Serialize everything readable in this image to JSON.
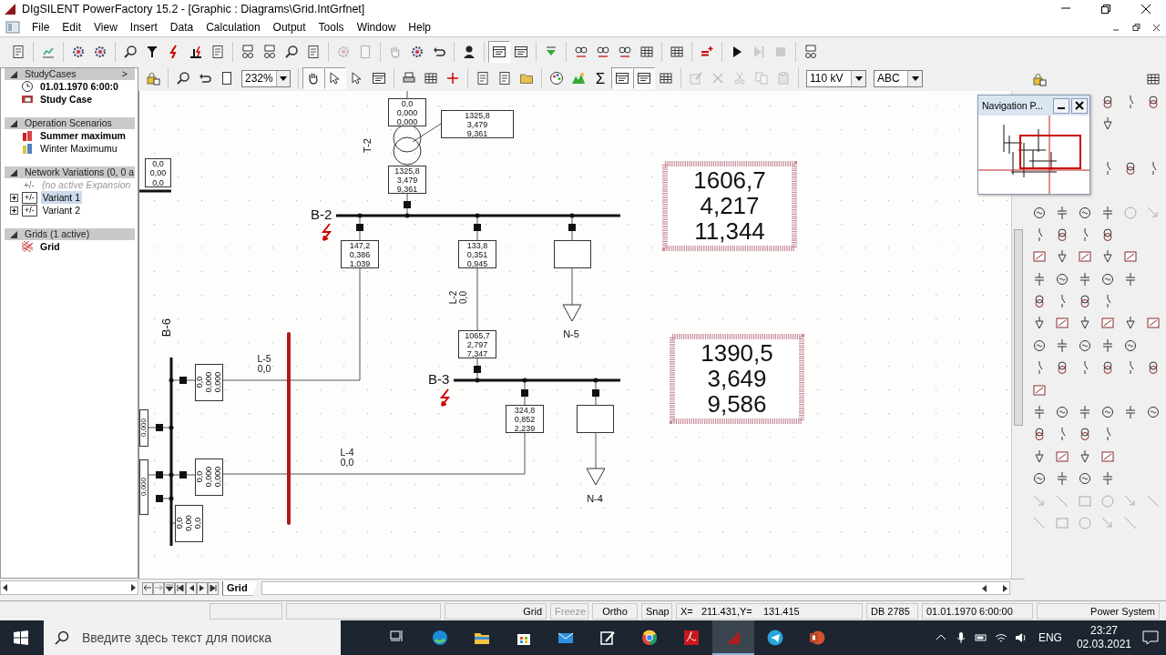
{
  "window": {
    "title": "DIgSILENT PowerFactory 15.2 - [Graphic : Diagrams\\Grid.IntGrfnet]"
  },
  "menu": [
    "File",
    "Edit",
    "View",
    "Insert",
    "Data",
    "Calculation",
    "Output",
    "Tools",
    "Window",
    "Help"
  ],
  "toolbar_main": [
    {
      "kind": "icon",
      "disabled": false,
      "pressed": false
    },
    {
      "kind": "separator"
    },
    {
      "kind": "icon",
      "disabled": false,
      "pressed": false
    },
    {
      "kind": "separator"
    },
    {
      "kind": "icon",
      "disabled": false,
      "pressed": false
    },
    {
      "kind": "icon",
      "disabled": false,
      "pressed": false
    },
    {
      "kind": "separator"
    },
    {
      "kind": "icon",
      "disabled": false,
      "pressed": false
    },
    {
      "kind": "icon",
      "disabled": false,
      "pressed": false
    },
    {
      "kind": "icon",
      "disabled": false,
      "pressed": false
    },
    {
      "kind": "icon",
      "disabled": false,
      "pressed": false
    },
    {
      "kind": "icon",
      "disabled": false,
      "pressed": false
    },
    {
      "kind": "separator"
    },
    {
      "kind": "icon",
      "disabled": false,
      "pressed": false
    },
    {
      "kind": "icon",
      "disabled": false,
      "pressed": false
    },
    {
      "kind": "icon",
      "disabled": false,
      "pressed": false
    },
    {
      "kind": "icon",
      "disabled": false,
      "pressed": false
    },
    {
      "kind": "separator"
    },
    {
      "kind": "icon",
      "disabled": true,
      "pressed": false
    },
    {
      "kind": "icon",
      "disabled": true,
      "pressed": false
    },
    {
      "kind": "separator"
    },
    {
      "kind": "icon",
      "disabled": true,
      "pressed": false
    },
    {
      "kind": "icon",
      "disabled": false,
      "pressed": false
    },
    {
      "kind": "icon",
      "disabled": false,
      "pressed": false
    },
    {
      "kind": "separator"
    },
    {
      "kind": "icon",
      "disabled": false,
      "pressed": false
    },
    {
      "kind": "separator"
    },
    {
      "kind": "icon",
      "disabled": false,
      "pressed": true
    },
    {
      "kind": "icon",
      "disabled": false,
      "pressed": false
    },
    {
      "kind": "separator"
    },
    {
      "kind": "icon",
      "disabled": false,
      "pressed": false
    },
    {
      "kind": "separator"
    },
    {
      "kind": "icon",
      "disabled": false,
      "pressed": false
    },
    {
      "kind": "icon",
      "disabled": false,
      "pressed": false
    },
    {
      "kind": "icon",
      "disabled": false,
      "pressed": false
    },
    {
      "kind": "icon",
      "disabled": false,
      "pressed": false
    },
    {
      "kind": "separator"
    },
    {
      "kind": "icon",
      "disabled": false,
      "pressed": false
    },
    {
      "kind": "separator"
    },
    {
      "kind": "icon",
      "disabled": false,
      "pressed": false
    },
    {
      "kind": "separator"
    },
    {
      "kind": "icon",
      "disabled": false,
      "pressed": false
    },
    {
      "kind": "icon",
      "disabled": true,
      "pressed": false
    },
    {
      "kind": "icon",
      "disabled": true,
      "pressed": false
    },
    {
      "kind": "separator"
    },
    {
      "kind": "icon",
      "disabled": false,
      "pressed": false
    }
  ],
  "toolbar_graphic": [
    {
      "kind": "icon",
      "disabled": false,
      "pressed": false
    },
    {
      "kind": "separator"
    },
    {
      "kind": "icon",
      "disabled": false,
      "pressed": false
    },
    {
      "kind": "icon",
      "disabled": false,
      "pressed": false
    },
    {
      "kind": "icon",
      "disabled": false,
      "pressed": false
    },
    {
      "kind": "combo",
      "value": "232%"
    },
    {
      "kind": "separator"
    },
    {
      "kind": "icon",
      "disabled": false,
      "pressed": true
    },
    {
      "kind": "icon",
      "disabled": false,
      "pressed": true
    },
    {
      "kind": "icon",
      "disabled": false,
      "pressed": false
    },
    {
      "kind": "icon",
      "disabled": false,
      "pressed": false
    },
    {
      "kind": "separator"
    },
    {
      "kind": "icon",
      "disabled": false,
      "pressed": false
    },
    {
      "kind": "icon",
      "disabled": false,
      "pressed": false
    },
    {
      "kind": "icon",
      "disabled": false,
      "pressed": false
    },
    {
      "kind": "separator"
    },
    {
      "kind": "icon",
      "disabled": false,
      "pressed": false
    },
    {
      "kind": "icon",
      "disabled": false,
      "pressed": false
    },
    {
      "kind": "icon",
      "disabled": false,
      "pressed": false
    },
    {
      "kind": "separator"
    },
    {
      "kind": "icon",
      "disabled": false,
      "pressed": false
    },
    {
      "kind": "icon",
      "disabled": false,
      "pressed": false
    },
    {
      "kind": "glyph",
      "text": "Σ",
      "disabled": false,
      "pressed": false
    },
    {
      "kind": "icon",
      "disabled": false,
      "pressed": true
    },
    {
      "kind": "icon",
      "disabled": false,
      "pressed": true
    },
    {
      "kind": "icon",
      "disabled": false,
      "pressed": false
    },
    {
      "kind": "separator"
    },
    {
      "kind": "icon",
      "disabled": true,
      "pressed": false
    },
    {
      "kind": "icon",
      "disabled": true,
      "pressed": false
    },
    {
      "kind": "icon",
      "disabled": true,
      "pressed": false
    },
    {
      "kind": "icon",
      "disabled": true,
      "pressed": false
    },
    {
      "kind": "icon",
      "disabled": true,
      "pressed": false
    },
    {
      "kind": "separator"
    },
    {
      "kind": "combo",
      "value": "110 kV"
    },
    {
      "kind": "combo",
      "value": "ABC"
    }
  ],
  "project_tree": [
    {
      "title": "StudyCases",
      "more": ">",
      "items": [
        {
          "kind": "item",
          "label": "01.01.1970 6:00:0",
          "active": true,
          "selected": false
        },
        {
          "kind": "item",
          "label": "Study Case",
          "active": true,
          "selected": false
        }
      ]
    },
    {
      "title": "Operation Scenarios",
      "items": [
        {
          "kind": "item",
          "label": "Summer maximum",
          "active": true,
          "selected": false
        },
        {
          "kind": "item",
          "label": "Winter Maximumu",
          "active": false,
          "selected": false
        }
      ]
    },
    {
      "title": "Network Variations (0, 0 a",
      "items": [
        {
          "kind": "note",
          "tag": "+/-",
          "label": "(no active Expansion",
          "active": false,
          "selected": false
        },
        {
          "kind": "variant",
          "tag": "+/-",
          "label": "Variant 1",
          "active": false,
          "selected": true,
          "expanded": false
        },
        {
          "kind": "variant",
          "tag": "+/-",
          "label": "Variant 2",
          "active": false,
          "selected": false,
          "expanded": false
        }
      ]
    },
    {
      "title": "Grids (1 active)",
      "items": [
        {
          "kind": "item",
          "label": "Grid",
          "active": true,
          "selected": false
        }
      ]
    }
  ],
  "diagram": {
    "labels": [
      "T-2",
      "B-2",
      "L-2",
      "0,0",
      "N-5",
      "B-3",
      "N-4",
      "B-6",
      "L-5",
      "0,0",
      "L-4",
      "0,0"
    ],
    "result_boxes": [
      {
        "lines": [
          "0,0",
          "0,000",
          "0,000"
        ]
      },
      {
        "lines": [
          "1325,8",
          "3,479",
          "9,361"
        ]
      },
      {
        "lines": [
          "1325,8",
          "3,479",
          "9,361"
        ]
      },
      {
        "lines": [
          "147,2",
          "0,386",
          "1,039"
        ]
      },
      {
        "lines": [
          "133,8",
          "0,351",
          "0,945"
        ]
      },
      {
        "lines": [
          "1065,7",
          "2,797",
          "7,347"
        ]
      },
      {
        "lines": [
          "324,8",
          "0,852",
          "2,239"
        ]
      },
      {
        "lines": [
          "0,0",
          "0,00",
          "0,0"
        ]
      },
      {
        "lines": [
          "0,0",
          "0,000",
          "0,000"
        ]
      },
      {
        "lines": [
          "0,0",
          "0,000",
          "0,000"
        ]
      },
      {
        "lines": [
          "0,0",
          "0,00",
          "0,0"
        ]
      },
      {
        "lines": [
          "0,000"
        ]
      },
      {
        "lines": [
          "0,000"
        ]
      }
    ],
    "summary_boxes": [
      {
        "lines": [
          "1606,7",
          "4,217",
          "11,344"
        ]
      },
      {
        "lines": [
          "1390,5",
          "3,649",
          "9,586"
        ]
      }
    ]
  },
  "navigation_panel": {
    "title": "Navigation P..."
  },
  "page_tabs": [
    {
      "label": "Grid",
      "selected": true
    }
  ],
  "status_bar": [
    {
      "text": "Grid",
      "disabled": false
    },
    {
      "text": "Freeze",
      "disabled": true
    },
    {
      "text": "Ortho",
      "disabled": false
    },
    {
      "text": "Snap",
      "disabled": false
    },
    {
      "text": "X=   211.431,Y=    131.415",
      "disabled": false
    },
    {
      "text": "DB 2785",
      "disabled": false
    },
    {
      "text": "01.01.1970 6:00:00",
      "disabled": false
    },
    {
      "text": "Power System",
      "disabled": false
    }
  ],
  "taskbar": {
    "search": {
      "placeholder": "Введите здесь текст для поиска"
    },
    "apps": [
      {
        "selected": false
      },
      {
        "selected": false
      },
      {
        "selected": false
      },
      {
        "selected": false
      },
      {
        "selected": false
      },
      {
        "selected": false
      },
      {
        "selected": false
      },
      {
        "selected": false
      },
      {
        "selected": true
      },
      {
        "selected": false
      },
      {
        "selected": false
      }
    ],
    "language": "ENG",
    "time": "23:27",
    "date": "02.03.2021"
  }
}
